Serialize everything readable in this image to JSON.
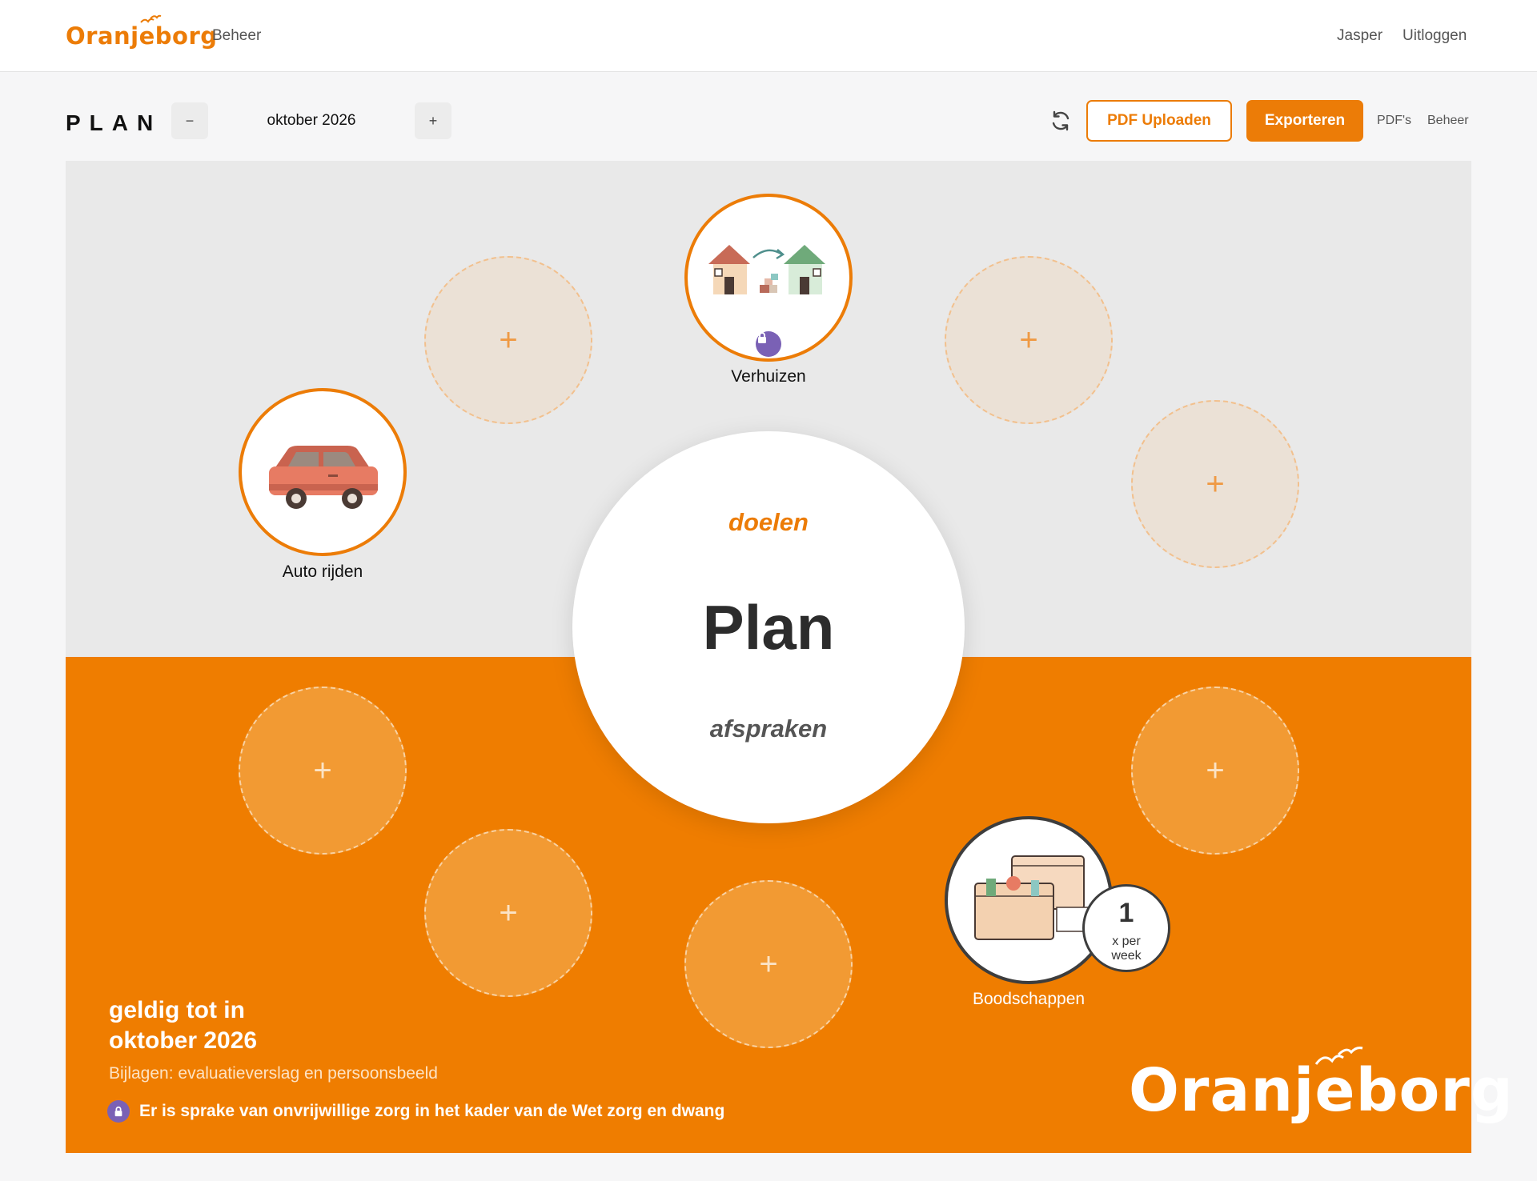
{
  "brand": {
    "name": "Oranjeborg",
    "color": "#ec7c07"
  },
  "nav": {
    "beheer": "Beheer",
    "user": "Jasper",
    "logout": "Uitloggen"
  },
  "toolbar": {
    "title": "PLAN",
    "decrement": "−",
    "month": "oktober 2026",
    "increment": "+",
    "refresh_icon": "refresh-icon",
    "pdf_upload": "PDF Uploaden",
    "export": "Exporteren",
    "pdfs": "PDF's",
    "beheer": "Beheer"
  },
  "center": {
    "top": "doelen",
    "main": "Plan",
    "bottom": "afspraken"
  },
  "goals": [
    {
      "label": "Verhuizen",
      "icon": "moving-houses-icon",
      "locked": true
    },
    {
      "label": "Auto rijden",
      "icon": "car-icon",
      "locked": false
    }
  ],
  "agreements": [
    {
      "label": "Boodschappen",
      "icon": "groceries-icon",
      "frequency": "1",
      "frequency_unit": "x per week"
    }
  ],
  "empty_slot_symbol": "+",
  "footer": {
    "valid_title": "geldig tot in\noktober 2026",
    "attachments": "Bijlagen: evaluatieverslag en persoonsbeeld",
    "wzd_notice": "Er is sprake van onvrijwillige zorg in het kader van de Wet zorg en dwang"
  },
  "colors": {
    "orange": "#ef7d00",
    "lock_purple": "#7a61b5",
    "grey_panel": "#e9e9e9"
  }
}
